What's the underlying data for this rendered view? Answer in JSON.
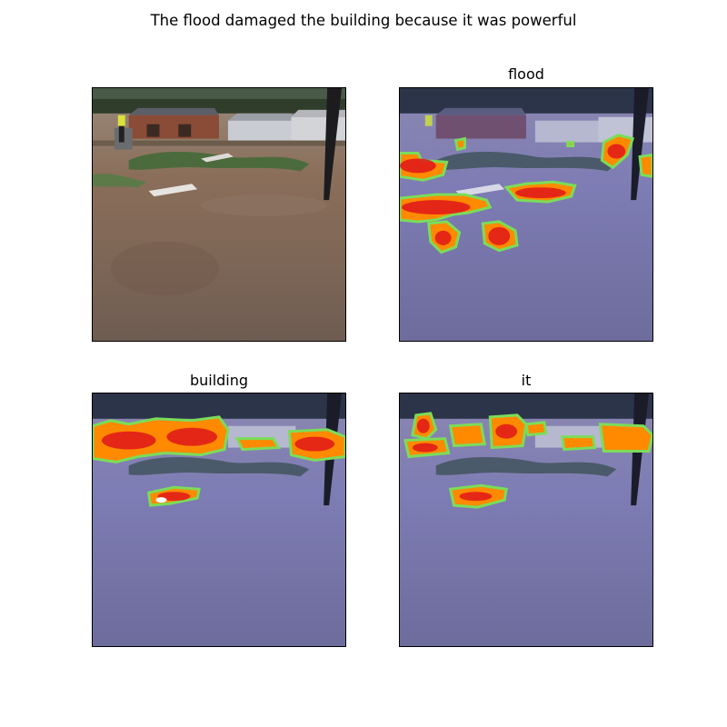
{
  "figure": {
    "suptitle": "The flood damaged the building because it was powerful"
  },
  "panels": [
    {
      "title": ""
    },
    {
      "title": "flood"
    },
    {
      "title": "building"
    },
    {
      "title": "it"
    }
  ],
  "colors": {
    "background": "#ffffff",
    "frame": "#000000",
    "water_original": "#8a7060",
    "water_tinted": "#7c7eb2",
    "heat_core": "#e0151a",
    "heat_mid": "#ff8a00",
    "heat_edge": "#7bdc5a"
  }
}
